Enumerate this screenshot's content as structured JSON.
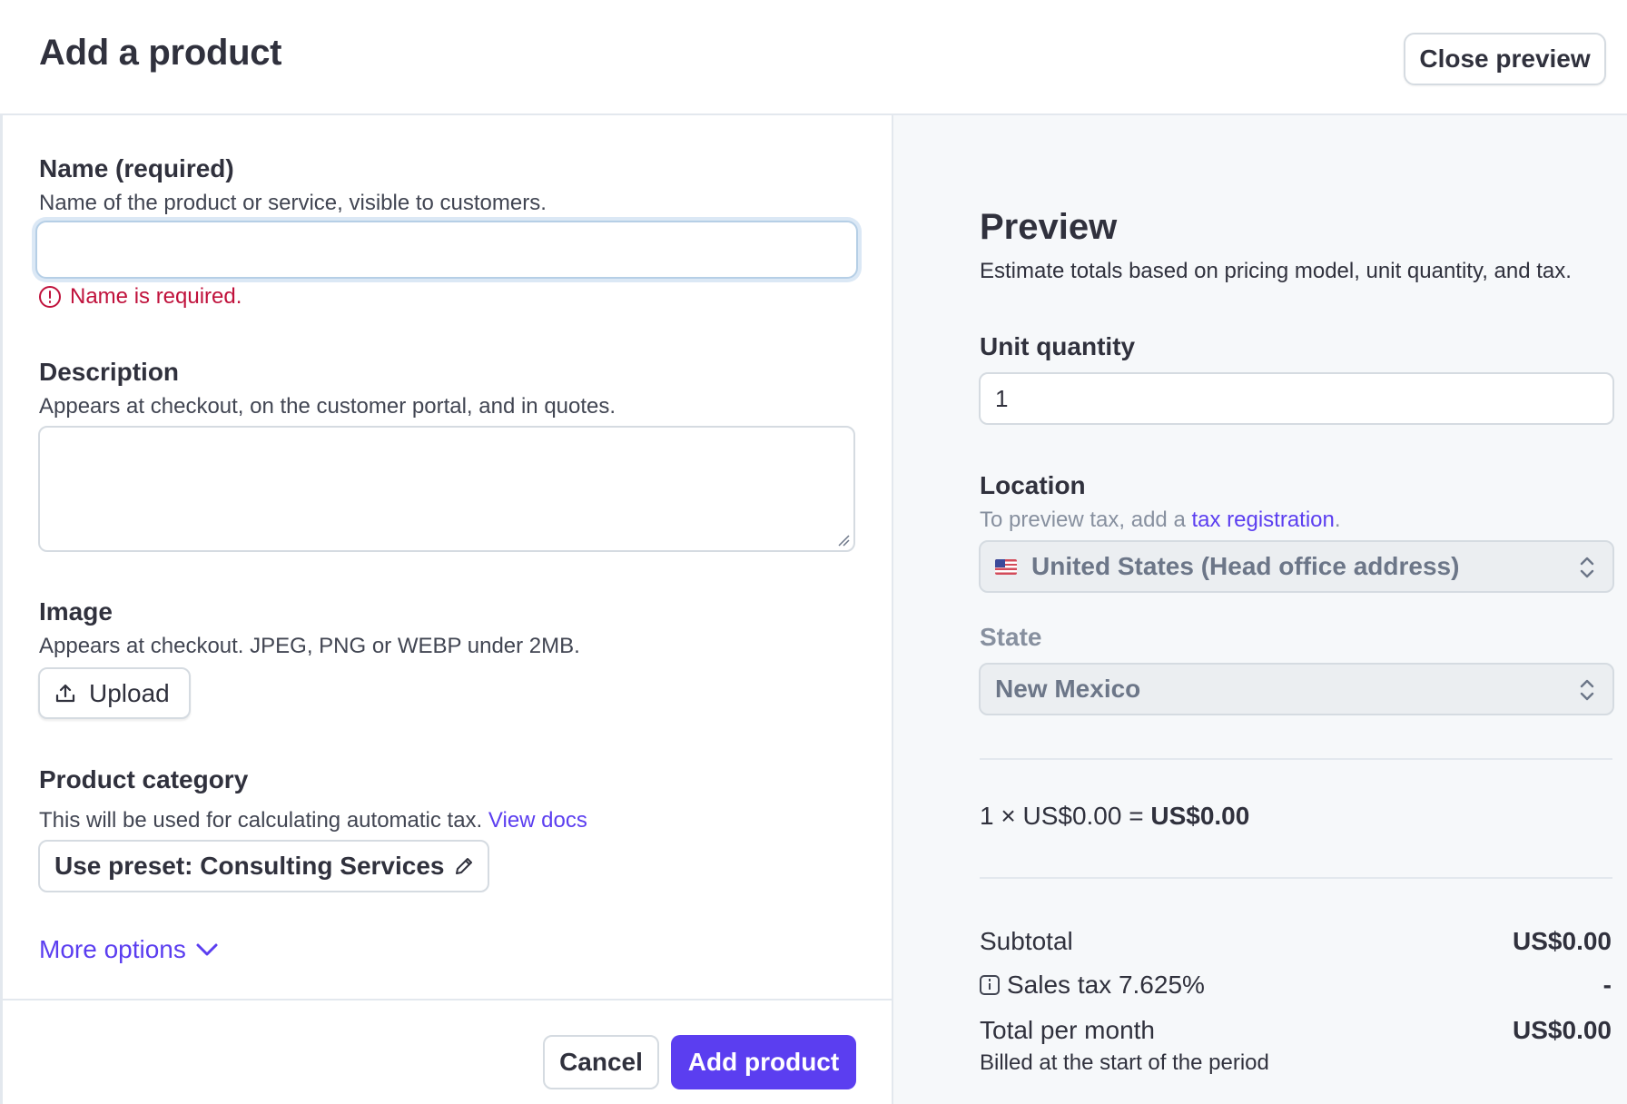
{
  "header": {
    "title": "Add a product",
    "close_preview_label": "Close preview"
  },
  "form": {
    "name": {
      "label": "Name (required)",
      "help": "Name of the product or service, visible to customers.",
      "value": "",
      "error": "Name is required."
    },
    "description": {
      "label": "Description",
      "help": "Appears at checkout, on the customer portal, and in quotes.",
      "value": ""
    },
    "image": {
      "label": "Image",
      "help": "Appears at checkout. JPEG, PNG or WEBP under 2MB.",
      "upload_label": "Upload"
    },
    "category": {
      "label": "Product category",
      "help": "This will be used for calculating automatic tax.",
      "link": "View docs",
      "preset_label": "Use preset: Consulting Services"
    },
    "more_options": "More options",
    "cancel_label": "Cancel",
    "submit_label": "Add product"
  },
  "preview": {
    "title": "Preview",
    "subtitle": "Estimate totals based on pricing model, unit quantity, and tax.",
    "unit_quantity": {
      "label": "Unit quantity",
      "value": "1"
    },
    "location": {
      "label": "Location",
      "help_prefix": "To preview tax, add a ",
      "help_link": "tax registration",
      "help_suffix": ".",
      "value": "United States (Head office address)"
    },
    "state": {
      "label": "State",
      "value": "New Mexico"
    },
    "calc": {
      "prefix": "1 × US$0.00 = ",
      "result": "US$0.00"
    },
    "summary": {
      "subtotal_label": "Subtotal",
      "subtotal_value": "US$0.00",
      "tax_label": "Sales tax 7.625%",
      "tax_value": "-",
      "total_label": "Total per month",
      "total_value": "US$0.00",
      "billed_note": "Billed at the start of the period"
    }
  },
  "colors": {
    "accent": "#5b3ef0",
    "error": "#c0123c",
    "text": "#30313d",
    "muted": "#87909f",
    "panel_bg": "#f6f8fa"
  }
}
